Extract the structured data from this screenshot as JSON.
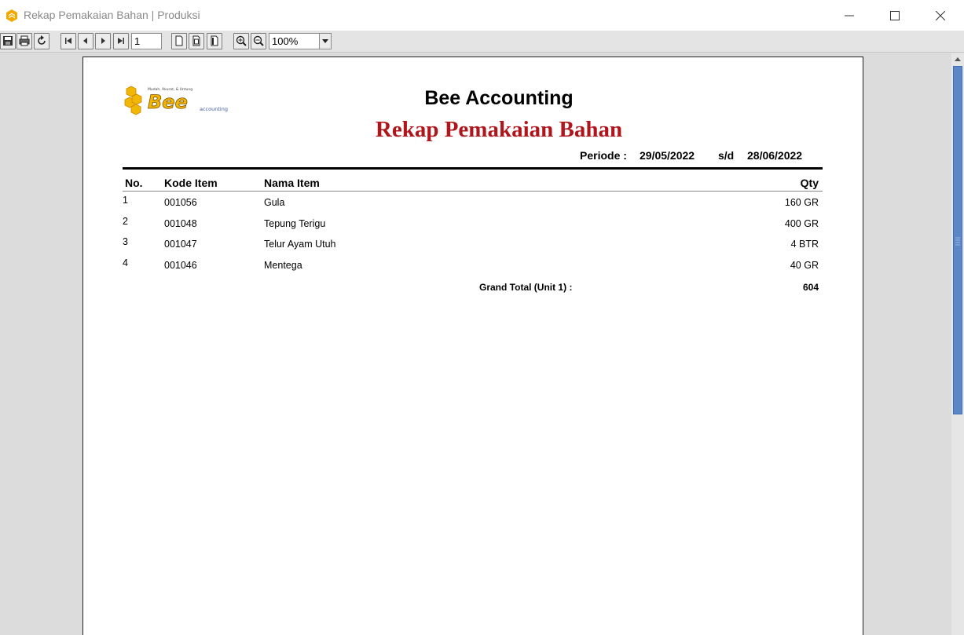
{
  "window": {
    "title": "Rekap Pemakaian Bahan | Produksi",
    "icons": {
      "app": "bee-app-icon",
      "minimize": "minimize-icon",
      "maximize": "maximize-icon",
      "close": "close-icon"
    }
  },
  "toolbar": {
    "page_number": "1",
    "zoom": "100%",
    "buttons": [
      "save-icon",
      "print-icon",
      "refresh-icon",
      "first-page-icon",
      "prev-page-icon",
      "next-page-icon",
      "last-page-icon",
      "single-page-icon",
      "page-width-icon",
      "full-page-icon",
      "zoom-in-icon",
      "zoom-out-icon"
    ]
  },
  "report": {
    "company": "Bee Accounting",
    "title": "Rekap Pemakaian Bahan",
    "title_color": "#b0151b",
    "periode_label": "Periode :",
    "periode_start": "29/05/2022",
    "periode_sep": "s/d",
    "periode_end": "28/06/2022",
    "logo": {
      "tagline": "Mudah, Akurat, & Untung",
      "wordmark": "Bee",
      "subtext": "accounting"
    },
    "columns": {
      "no": "No.",
      "kode": "Kode Item",
      "nama": "Nama Item",
      "qty": "Qty"
    },
    "rows": [
      {
        "no": "1",
        "kode": "001056",
        "nama": "Gula",
        "qty": "160 GR"
      },
      {
        "no": "2",
        "kode": "001048",
        "nama": "Tepung Terigu",
        "qty": "400 GR"
      },
      {
        "no": "3",
        "kode": "001047",
        "nama": "Telur Ayam Utuh",
        "qty": "4 BTR"
      },
      {
        "no": "4",
        "kode": "001046",
        "nama": "Mentega",
        "qty": "40 GR"
      }
    ],
    "grand_total_label": "Grand Total (Unit 1) :",
    "grand_total_value": "604"
  },
  "colors": {
    "accent_scroll": "#5b86c8",
    "logo_yellow": "#f2b705"
  }
}
